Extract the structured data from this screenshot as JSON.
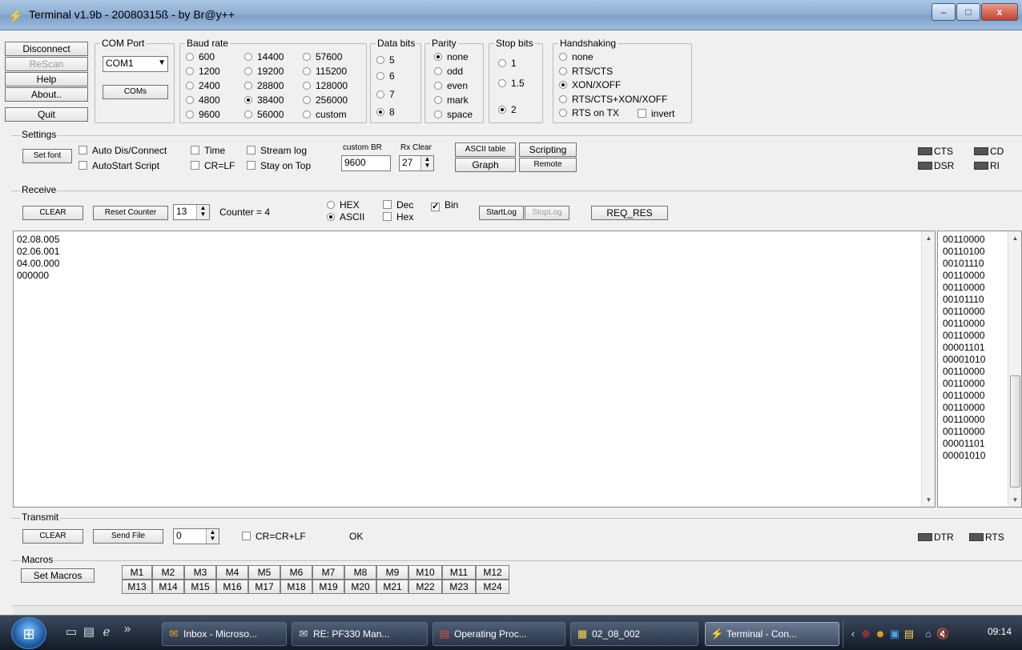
{
  "window": {
    "title": "Terminal v1.9b - 20080315ß - by Br@y++",
    "controls": {
      "minimize": "–",
      "maximize": "□",
      "close": "x"
    }
  },
  "connection": {
    "buttons": [
      "Disconnect",
      "ReScan",
      "Help",
      "About..",
      "Quit"
    ]
  },
  "com_port": {
    "label": "COM Port",
    "value": "COM1",
    "coms_button": "COMs"
  },
  "baud_rate": {
    "label": "Baud rate",
    "options": [
      "600",
      "1200",
      "2400",
      "4800",
      "9600",
      "14400",
      "19200",
      "28800",
      "38400",
      "56000",
      "57600",
      "115200",
      "128000",
      "256000",
      "custom"
    ],
    "selected": "38400"
  },
  "data_bits": {
    "label": "Data bits",
    "options": [
      "5",
      "6",
      "7",
      "8"
    ],
    "selected": "8"
  },
  "parity": {
    "label": "Parity",
    "options": [
      "none",
      "odd",
      "even",
      "mark",
      "space"
    ],
    "selected": "none"
  },
  "stop_bits": {
    "label": "Stop bits",
    "options": [
      "1",
      "1.5",
      "2"
    ],
    "selected": "2"
  },
  "handshaking": {
    "label": "Handshaking",
    "options": [
      "none",
      "RTS/CTS",
      "XON/XOFF",
      "RTS/CTS+XON/XOFF",
      "RTS on TX"
    ],
    "selected": "XON/XOFF",
    "invert_label": "invert"
  },
  "settings": {
    "label": "Settings",
    "set_font": "Set font",
    "checks": {
      "auto_dis_connect": "Auto Dis/Connect",
      "autostart_script": "AutoStart Script",
      "time": "Time",
      "cr_lf": "CR=LF",
      "stream_log": "Stream log",
      "stay_on_top": "Stay on Top"
    },
    "custom_br_label": "custom BR",
    "custom_br_value": "9600",
    "rx_clear_label": "Rx Clear",
    "rx_clear_value": "27",
    "ascii_table": "ASCII table",
    "scripting": "Scripting",
    "graph": "Graph",
    "remote": "Remote",
    "signals": {
      "cts": "CTS",
      "cd": "CD",
      "dsr": "DSR",
      "ri": "RI"
    }
  },
  "receive": {
    "label": "Receive",
    "clear": "CLEAR",
    "reset_counter": "Reset Counter",
    "counter_spin": "13",
    "counter_text": "Counter = 4",
    "hex_label": "HEX",
    "ascii_label": "ASCII",
    "dec_label": "Dec",
    "bin_label": "Bin",
    "hex2_label": "Hex",
    "start_log": "StartLog",
    "stop_log": "StopLog",
    "req_res": "REQ_RES",
    "text_lines": "02.08.005\n02.06.001\n04.00.000\n000000",
    "bin_lines": "00110000\n00110100\n00101110\n00110000\n00110000\n00101110\n00110000\n00110000\n00110000\n00001101\n00001010\n00110000\n00110000\n00110000\n00110000\n00110000\n00110000\n00001101\n00001010"
  },
  "transmit": {
    "label": "Transmit",
    "clear": "CLEAR",
    "send_file": "Send File",
    "spin_value": "0",
    "cr_label": "CR=CR+LF",
    "status": "OK",
    "signals": {
      "dtr": "DTR",
      "rts": "RTS"
    }
  },
  "macros": {
    "label": "Macros",
    "set_macros": "Set Macros",
    "row1": [
      "M1",
      "M2",
      "M3",
      "M4",
      "M5",
      "M6",
      "M7",
      "M8",
      "M9",
      "M10",
      "M11",
      "M12"
    ],
    "row2": [
      "M13",
      "M14",
      "M15",
      "M16",
      "M17",
      "M18",
      "M19",
      "M20",
      "M21",
      "M22",
      "M23",
      "M24"
    ]
  },
  "taskbar": {
    "start_label": "start",
    "overflow": "»",
    "tasks": [
      "Inbox - Microso...",
      "RE: PF330 Man...",
      "Operating Proc...",
      "02_08_002",
      "Terminal - Con..."
    ],
    "active_task": "Terminal - Con...",
    "clock": "09:14"
  }
}
